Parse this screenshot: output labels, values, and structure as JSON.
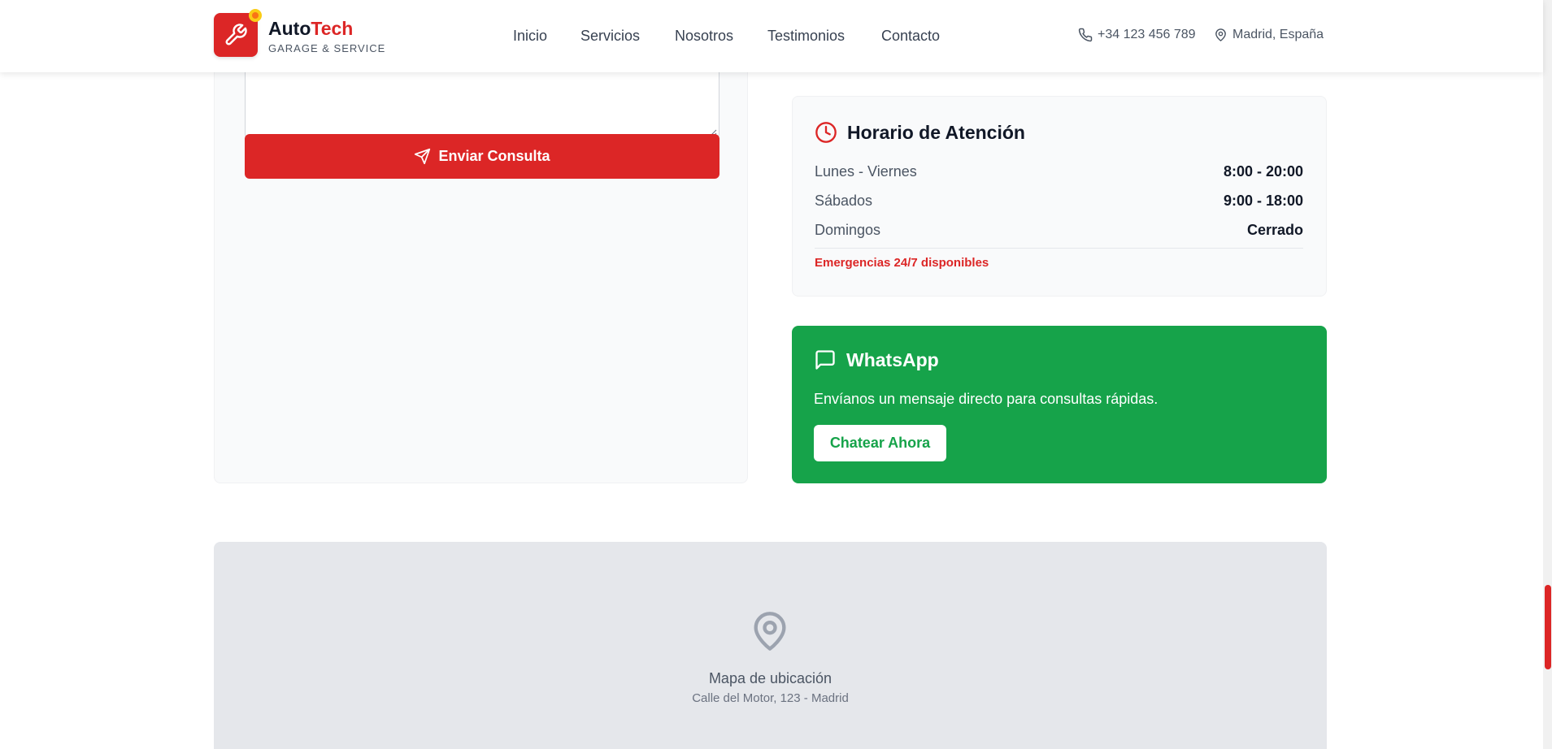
{
  "header": {
    "brand_part1": "Auto",
    "brand_part2": "Tech",
    "brand_sub": "GARAGE & SERVICE",
    "nav": [
      "Inicio",
      "Servicios",
      "Nosotros",
      "Testimonios",
      "Contacto"
    ],
    "phone": "+34 123 456 789",
    "location": "Madrid, España"
  },
  "form": {
    "submit_label": "Enviar Consulta"
  },
  "hours": {
    "title": "Horario de Atención",
    "rows": [
      {
        "day": "Lunes - Viernes",
        "time": "8:00 - 20:00"
      },
      {
        "day": "Sábados",
        "time": "9:00 - 18:00"
      },
      {
        "day": "Domingos",
        "time": "Cerrado"
      }
    ],
    "emergency": "Emergencias 24/7 disponibles"
  },
  "whatsapp": {
    "title": "WhatsApp",
    "description": "Envíanos un mensaje directo para consultas rápidas.",
    "button_label": "Chatear Ahora"
  },
  "map": {
    "label": "Mapa de ubicación",
    "address": "Calle del Motor, 123 - Madrid"
  },
  "colors": {
    "brand_red": "#dc2626",
    "whatsapp_green": "#16a34a",
    "logo_dot": "#facc15"
  },
  "icons": {
    "logo": "wrench-icon",
    "phone": "phone-icon",
    "location": "map-pin-icon",
    "submit": "send-icon",
    "hours": "clock-icon",
    "whatsapp": "message-square-icon",
    "map": "map-pin-icon"
  }
}
